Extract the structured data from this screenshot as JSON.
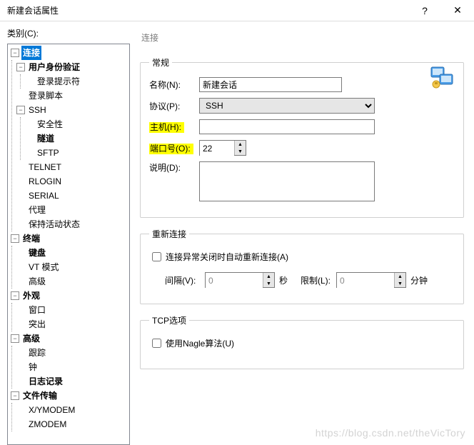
{
  "window": {
    "title": "新建会话属性",
    "help": "?",
    "close": "✕"
  },
  "category_label": "类别(C):",
  "tree": {
    "connection": "连接",
    "user_auth": "用户身份验证",
    "login_prompt": "登录提示符",
    "login_script": "登录脚本",
    "ssh": "SSH",
    "security": "安全性",
    "tunnel": "隧道",
    "sftp": "SFTP",
    "telnet": "TELNET",
    "rlogin": "RLOGIN",
    "serial": "SERIAL",
    "proxy": "代理",
    "keepalive": "保持活动状态",
    "terminal": "终端",
    "keyboard": "键盘",
    "vtmode": "VT 模式",
    "advanced_t": "高级",
    "appearance": "外观",
    "window": "窗口",
    "highlight": "突出",
    "advanced": "高级",
    "trace": "跟踪",
    "bell": "钟",
    "logging": "日志记录",
    "filetransfer": "文件传输",
    "xymodem": "X/YMODEM",
    "zmodem": "ZMODEM"
  },
  "panel": {
    "heading": "连接",
    "group_general": "常规",
    "name_label": "名称(N):",
    "name_value": "新建会话",
    "protocol_label": "协议(P):",
    "protocol_value": "SSH",
    "host_label": "主机(H):",
    "host_value": "",
    "port_label": "端口号(O):",
    "port_value": "22",
    "desc_label": "说明(D):",
    "desc_value": "",
    "group_reconnect": "重新连接",
    "reconnect_chk": "连接异常关闭时自动重新连接(A)",
    "interval_label": "间隔(V):",
    "interval_value": "0",
    "seconds": "秒",
    "limit_label": "限制(L):",
    "limit_value": "0",
    "minutes": "分钟",
    "group_tcp": "TCP选项",
    "nagle_chk": "使用Nagle算法(U)"
  },
  "watermark": "https://blog.csdn.net/theVicTory"
}
